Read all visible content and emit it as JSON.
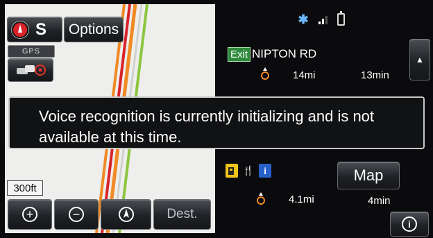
{
  "map": {
    "heading": "S",
    "options_label": "Options",
    "gps_label": "GPS",
    "scale_label": "300ft",
    "zoom_in_symbol": "+",
    "zoom_out_symbol": "−",
    "dest_label": "Dest."
  },
  "status": {
    "bluetooth_symbol": "✱"
  },
  "guidance": {
    "exit_label": "Exit",
    "street": "NIPTON RD",
    "distance": "14mi",
    "duration": "13min",
    "next_distance": "4.1mi",
    "next_duration": "4min"
  },
  "alert": {
    "message": "Voice recognition is currently initializing and is not available at this time."
  },
  "poi": {
    "food_symbol": "🍴",
    "info_symbol": "i"
  },
  "buttons": {
    "map_label": "Map",
    "info_symbol": "i",
    "scroll_up_symbol": "▲"
  },
  "colors": {
    "route_red": "#d9232a",
    "route_orange": "#f08a24",
    "road_green": "#8dc63f",
    "exit_green": "#2f8a3c",
    "info_blue": "#2760c8"
  },
  "icons": [
    "compass-icon",
    "traffic-icon",
    "bluetooth-icon",
    "signal-icon",
    "battery-icon",
    "route-icon",
    "fuel-icon",
    "food-icon",
    "info-icon",
    "orientation-icon"
  ]
}
